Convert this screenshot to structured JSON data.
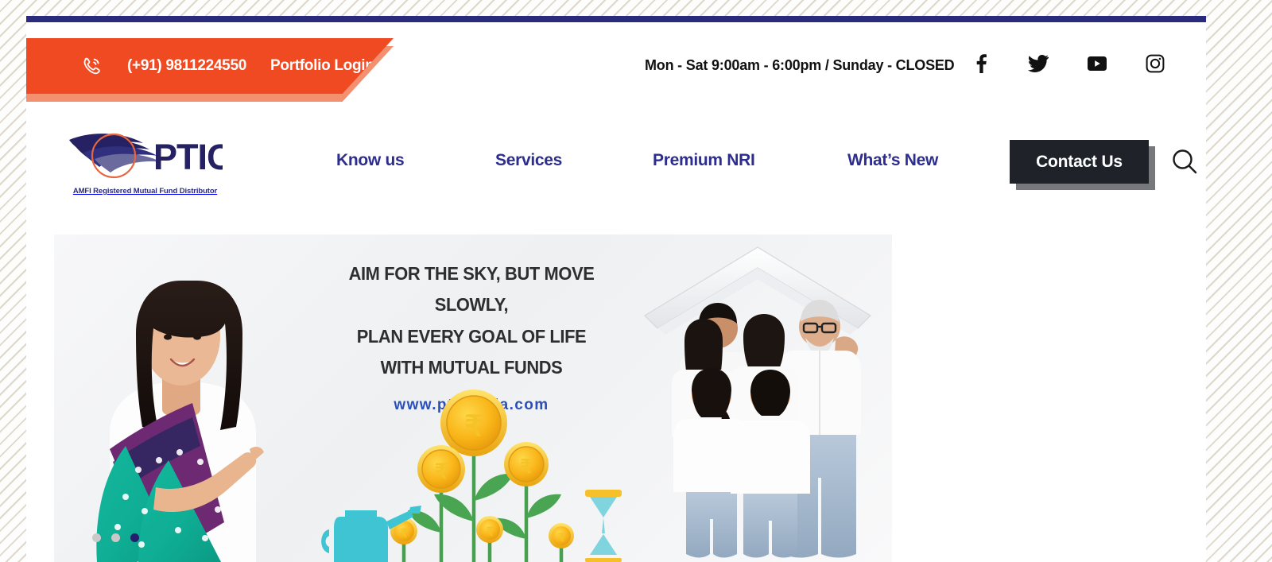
{
  "site": {
    "brand": "PTIC",
    "tagline": "AMFI Registered Mutual Fund Distributor"
  },
  "utility": {
    "phone": "(+91) 9811224550",
    "portfolio_login": "Portfolio Login",
    "hours": "Mon - Sat 9:00am - 6:00pm / Sunday - CLOSED",
    "social": [
      {
        "name": "facebook",
        "label": "Facebook"
      },
      {
        "name": "twitter",
        "label": "Twitter"
      },
      {
        "name": "youtube",
        "label": "YouTube"
      },
      {
        "name": "instagram",
        "label": "Instagram"
      }
    ]
  },
  "nav": {
    "items": [
      {
        "label": "Know us"
      },
      {
        "label": "Services"
      },
      {
        "label": "Premium NRI"
      },
      {
        "label": "What’s New"
      }
    ],
    "contact_label": "Contact Us",
    "search_label": "Search"
  },
  "hero": {
    "headline_line1": "AIM FOR THE SKY, BUT MOVE SLOWLY,",
    "headline_line2": "PLAN EVERY GOAL OF LIFE",
    "headline_line3": "WITH MUTUAL FUNDS",
    "url": "www.pticindia.com",
    "slides": [
      {
        "label": "Slide 1",
        "active": false
      },
      {
        "label": "Slide 2",
        "active": false
      },
      {
        "label": "Slide 3",
        "active": true
      }
    ]
  },
  "colors": {
    "orange": "#f04a23",
    "orange_shadow": "#f2906f",
    "navy": "#2b2b7d",
    "nav_blue": "#2d2d8f",
    "dark_button": "#1f2329",
    "button_shadow": "#76787b",
    "url_blue": "#2b4fb8",
    "dot_active": "#25206b",
    "dot_inactive": "#c9c9c9"
  }
}
